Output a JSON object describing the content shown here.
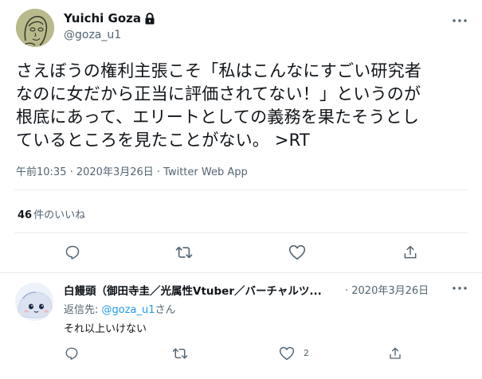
{
  "tweet": {
    "display_name": "Yuichi Goza",
    "handle": "@goza_u1",
    "text_lines": [
      "さえぼうの権利主張こそ「私はこんなにすごい研究者",
      "なのに女だから正当に評価されてない！」というのが",
      "根底にあって、エリートとしての義務を果たそうとし",
      "ているところを見たことがない。 >RT"
    ],
    "meta": "午前10:35 · 2020年3月26日 · Twitter Web App",
    "likes_count": "46",
    "likes_label": "件のいいね",
    "icons": [
      "lock-icon",
      "more-icon",
      "reply-icon",
      "retweet-icon",
      "like-icon",
      "share-icon"
    ]
  },
  "reply": {
    "display_name": "白饅頭（御田寺圭／光属性Vtuber／バーチャルツ...",
    "date": "· 2020年3月26日",
    "reply_to_prefix": "返信先: ",
    "reply_to_handle": "@goza_u1",
    "reply_to_suffix": "さん",
    "text": "それ以上いけない",
    "like_count": "2"
  },
  "colors": {
    "text": "#0f1419",
    "secondary": "#536471",
    "accent": "#1d9bf0",
    "divider": "#e6ecf0"
  }
}
